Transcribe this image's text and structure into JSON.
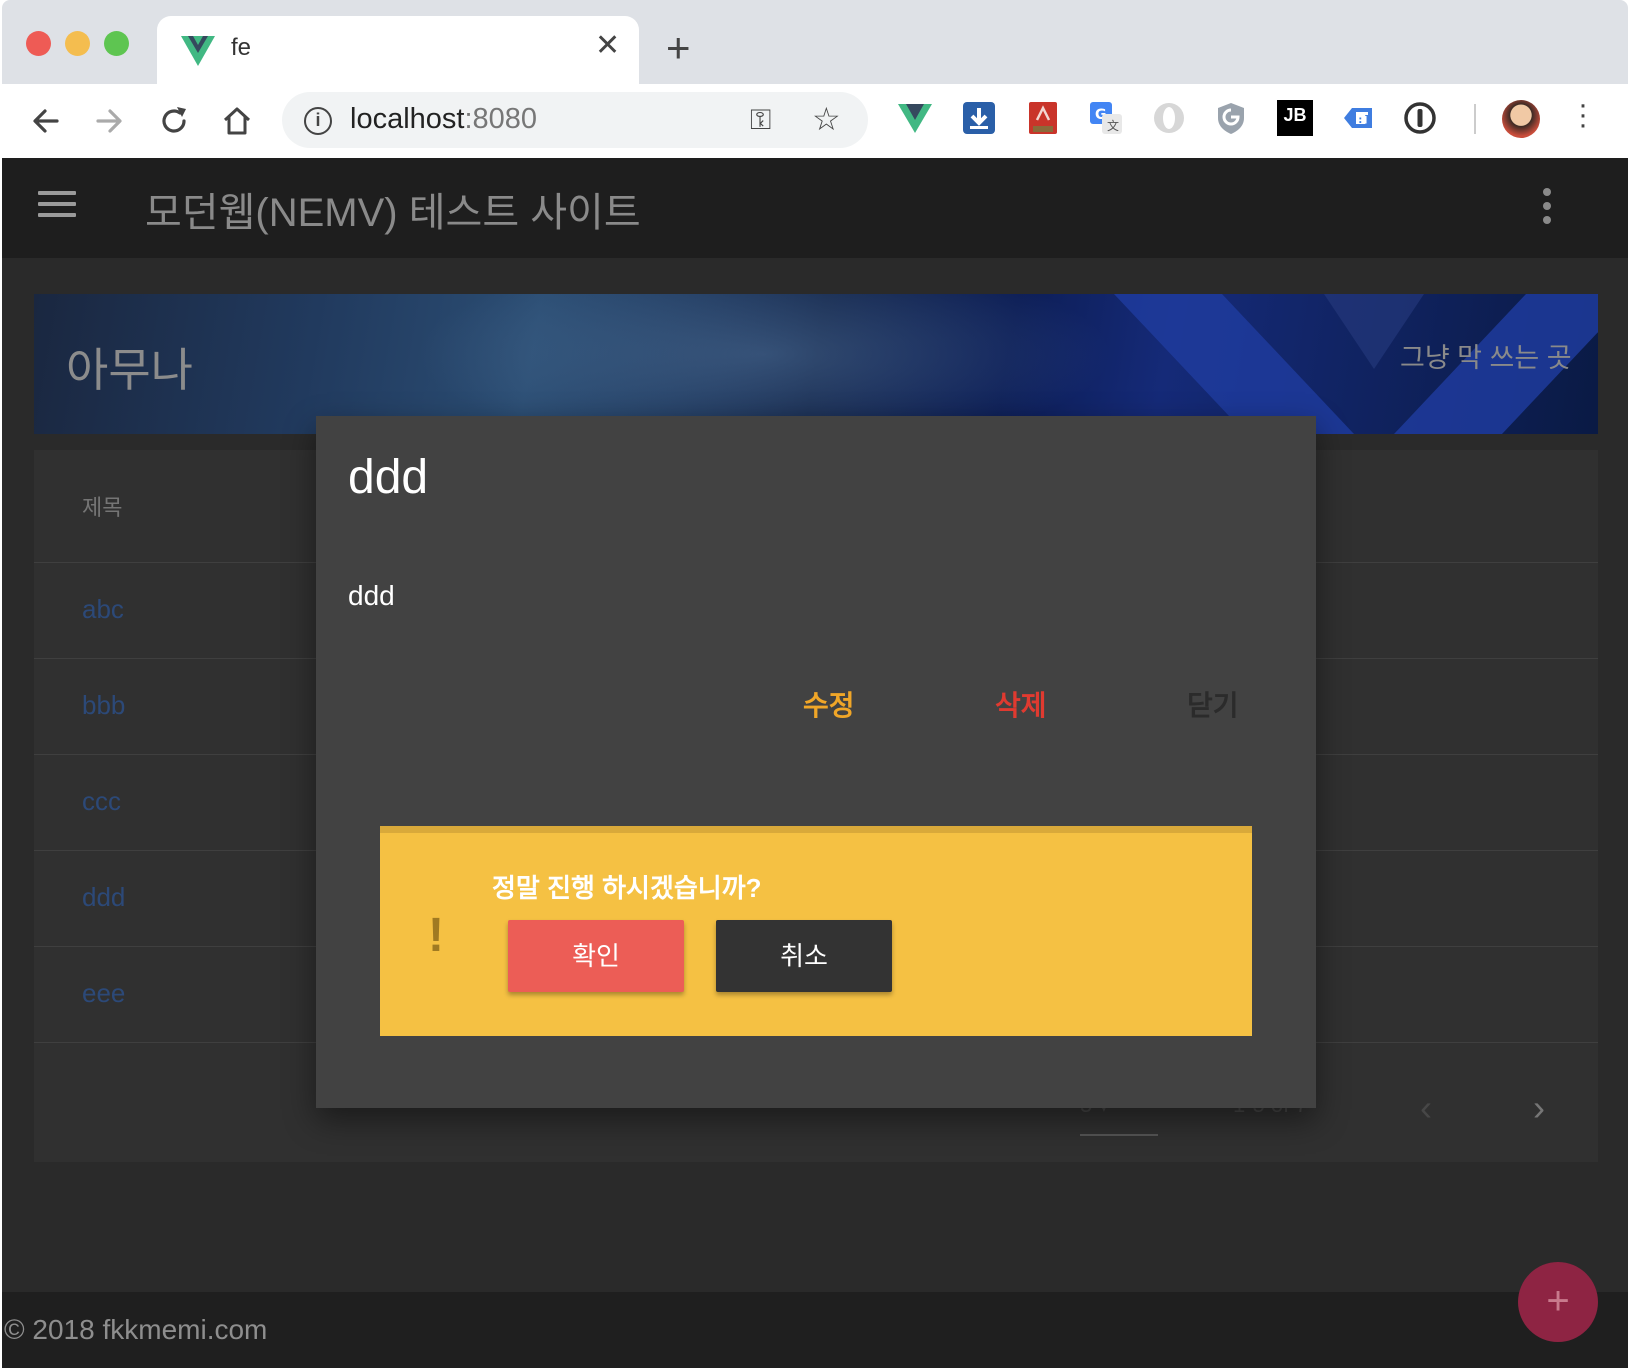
{
  "browser": {
    "tab_title": "fe",
    "new_tab": "+",
    "close_tab": "✕",
    "url_host": "localhost",
    "url_port": ":8080",
    "extensions": [
      "vue-devtools-icon",
      "download-icon",
      "pdf-icon",
      "translate-icon",
      "opera-icon",
      "shield-icon",
      "jetbrains-icon",
      "code-icon",
      "password-icon"
    ],
    "jetbrains_label": "JB"
  },
  "app": {
    "title": "모던웹(NEMV) 테스트 사이트",
    "hero_title": "아무나",
    "hero_subtitle": "그냥 막 쓰는 곳",
    "table": {
      "header": "제목",
      "rows": [
        "abc",
        "bbb",
        "ccc",
        "ddd",
        "eee"
      ]
    },
    "pagination": {
      "fragment_left": "5  ▾",
      "fragment_right": "1-5 of 7"
    },
    "footer": "© 2018 fkkmemi.com",
    "fab": "+"
  },
  "dialog": {
    "title": "ddd",
    "content": "ddd",
    "edit_label": "수정",
    "delete_label": "삭제",
    "close_label": "닫기"
  },
  "confirm": {
    "icon": "!",
    "message": "정말 진행 하시겠습니까?",
    "ok_label": "확인",
    "cancel_label": "취소"
  },
  "colors": {
    "edit": "#f0a628",
    "delete": "#e03a30",
    "alert_bg": "#f5c143",
    "ok_bg": "#ec5d56",
    "cancel_bg": "#333333",
    "fab_bg": "#8e2443"
  }
}
